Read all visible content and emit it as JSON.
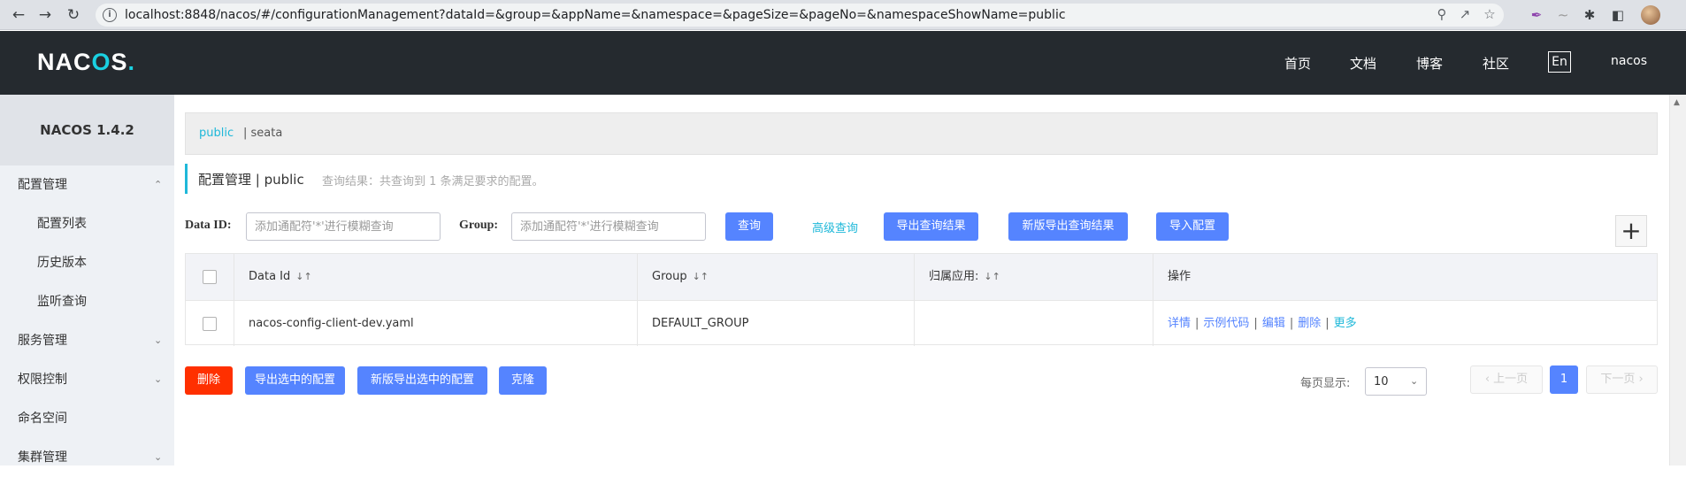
{
  "browser": {
    "url": "localhost:8848/nacos/#/configurationManagement?dataId=&group=&appName=&namespace=&pageSize=&pageNo=&namespaceShowName=public"
  },
  "header": {
    "logo_text": "NAC",
    "logo_text_2": "S",
    "logo_o": "O",
    "logo_dot": ".",
    "nav": [
      "首页",
      "文档",
      "博客",
      "社区"
    ],
    "lang": "En",
    "user": "nacos"
  },
  "sidebar": {
    "title": "NACOS 1.4.2",
    "items": [
      {
        "label": "配置管理",
        "expanded": true
      },
      {
        "label": "配置列表"
      },
      {
        "label": "历史版本"
      },
      {
        "label": "监听查询"
      },
      {
        "label": "服务管理"
      },
      {
        "label": "权限控制"
      },
      {
        "label": "命名空间"
      },
      {
        "label": "集群管理"
      }
    ]
  },
  "namespaces": {
    "active": "public",
    "other": "| seata"
  },
  "page": {
    "title": "配置管理  |  public",
    "result": "查询结果：共查询到 1 条满足要求的配置。"
  },
  "filters": {
    "dataid_label": "Data ID:",
    "dataid_placeholder": "添加通配符'*'进行模糊查询",
    "group_label": "Group:",
    "group_placeholder": "添加通配符'*'进行模糊查询",
    "query": "查询",
    "advanced": "高级查询",
    "export_result": "导出查询结果",
    "export_result_new": "新版导出查询结果",
    "import": "导入配置",
    "add": "+"
  },
  "table": {
    "headers": [
      "Data Id",
      "Group",
      "归属应用:",
      "操作"
    ],
    "rows": [
      {
        "data_id": "nacos-config-client-dev.yaml",
        "group": "DEFAULT_GROUP",
        "app": "",
        "ops": [
          "详情",
          "示例代码",
          "编辑",
          "删除",
          "更多"
        ]
      }
    ]
  },
  "bulk": {
    "delete": "删除",
    "export_selected": "导出选中的配置",
    "export_selected_new": "新版导出选中的配置",
    "clone": "克隆"
  },
  "pagination": {
    "per_page_label": "每页显示:",
    "per_page": "10",
    "prev": "上一页",
    "current": "1",
    "next": "下一页"
  },
  "colors": {
    "header_bg": "#252a2f",
    "primary": "#5584ff",
    "accent": "#1fb8d9",
    "danger": "#ff3000"
  }
}
